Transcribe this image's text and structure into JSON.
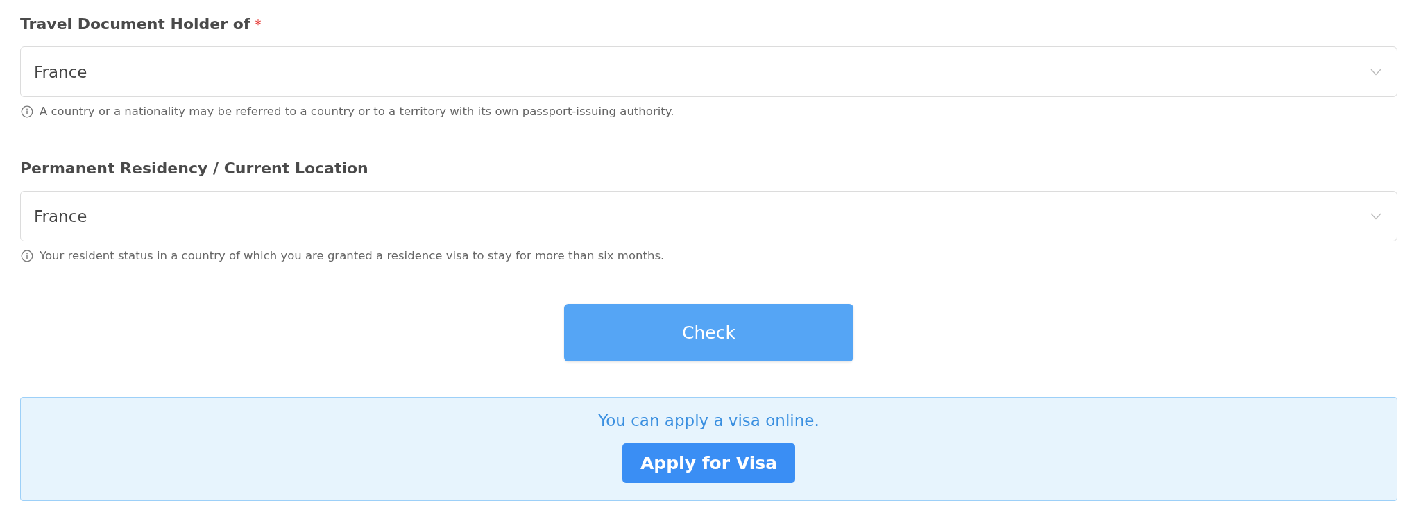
{
  "fields": [
    {
      "label": "Travel Document Holder of",
      "required": true,
      "value": "France",
      "hint": "A country or a nationality may be referred to a country or to a territory with its own passport-issuing authority."
    },
    {
      "label": "Permanent Residency / Current Location",
      "required": false,
      "value": "France",
      "hint": "Your resident status in a country of which you are granted a residence visa to stay for more than six months."
    }
  ],
  "required_mark": "*",
  "check_button": "Check",
  "result": {
    "message": "You can apply a visa online.",
    "button": "Apply for Visa"
  }
}
